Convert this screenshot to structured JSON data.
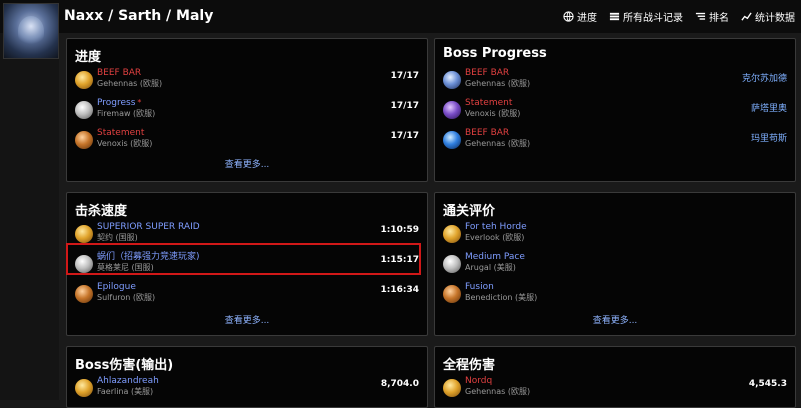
{
  "header": {
    "title": "Naxx / Sarth / Maly",
    "nav": [
      {
        "label": "进度",
        "icon": "globe-icon"
      },
      {
        "label": "所有战斗记录",
        "icon": "list-icon"
      },
      {
        "label": "排名",
        "icon": "ranking-icon"
      },
      {
        "label": "统计数据",
        "icon": "chart-icon"
      }
    ]
  },
  "panels": {
    "progress": {
      "title": "进度",
      "rows": [
        {
          "name": "BEEF BAR",
          "server": "Gehennas (欧服)",
          "value": "17/17"
        },
        {
          "name": "Progress",
          "server": "Firemaw (欧服)",
          "value": "17/17",
          "star": "*"
        },
        {
          "name": "Statement",
          "server": "Venoxis (欧服)",
          "value": "17/17"
        }
      ],
      "more": "查看更多..."
    },
    "boss_progress": {
      "title": "Boss Progress",
      "rows": [
        {
          "name": "BEEF BAR",
          "server": "Gehennas (欧服)",
          "value": "克尔苏加德"
        },
        {
          "name": "Statement",
          "server": "Venoxis (欧服)",
          "value": "萨塔里奥"
        },
        {
          "name": "BEEF BAR",
          "server": "Gehennas (欧服)",
          "value": "玛里苟斯"
        }
      ]
    },
    "kill_speed": {
      "title": "击杀速度",
      "rows": [
        {
          "name": "SUPERIOR SUPER RAID",
          "server": "契约 (国服)",
          "value": "1:10:59"
        },
        {
          "name": "蜗们（招募强力竞速玩家)",
          "server": "莫格莱尼 (国服)",
          "value": "1:15:17"
        },
        {
          "name": "Epilogue",
          "server": "Sulfuron (欧服)",
          "value": "1:16:34"
        }
      ],
      "more": "查看更多..."
    },
    "clear_rating": {
      "title": "通关评价",
      "rows": [
        {
          "name": "For teh Horde",
          "server": "Everlook (欧服)"
        },
        {
          "name": "Medium Pace",
          "server": "Arugal (美服)"
        },
        {
          "name": "Fusion",
          "server": "Benediction (美服)"
        }
      ],
      "more": "查看更多..."
    },
    "boss_damage": {
      "title": "Boss伤害(输出)",
      "rows": [
        {
          "name": "Ahlazandreah",
          "server": "Faerlina (美服)",
          "value": "8,704.0"
        }
      ]
    },
    "full_damage": {
      "title": "全程伤害",
      "rows": [
        {
          "name": "Nordq",
          "server": "Gehennas (欧服)",
          "value": "4,545.3"
        }
      ]
    }
  },
  "colors": {
    "red_name": "#e04040",
    "blue_name": "#7f9dff",
    "link": "#8fb4ff",
    "highlight_border": "#d11818"
  }
}
